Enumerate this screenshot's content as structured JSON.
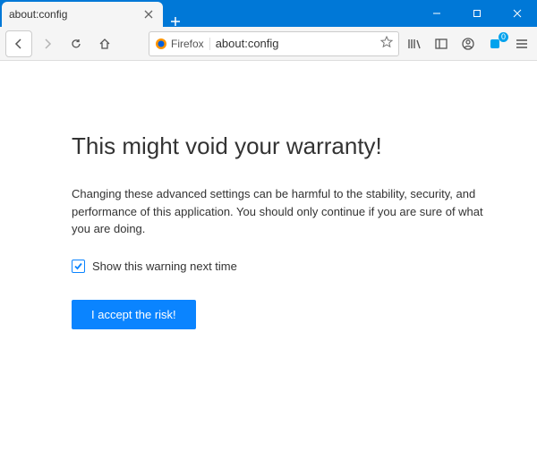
{
  "tab": {
    "title": "about:config"
  },
  "urlbar": {
    "identity": "Firefox",
    "url": "about:config"
  },
  "extension_badge": "0",
  "page": {
    "heading": "This might void your warranty!",
    "body": "Changing these advanced settings can be harmful to the stability, security, and performance of this application. You should only continue if you are sure of what you are doing.",
    "checkbox_label": "Show this warning next time",
    "accept_label": "I accept the risk!"
  }
}
